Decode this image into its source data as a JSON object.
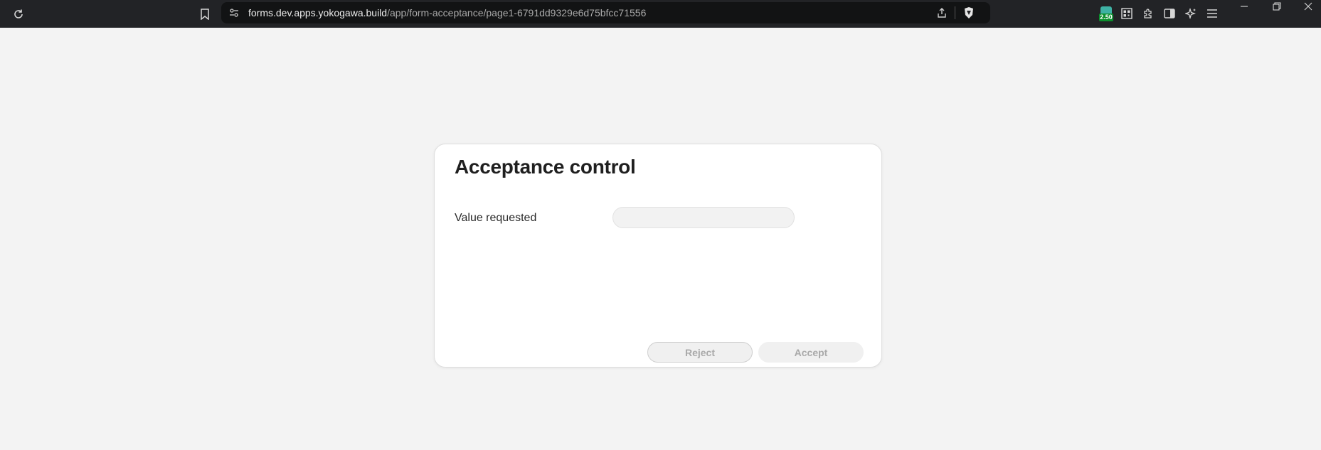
{
  "browser": {
    "url_host": "forms.dev.apps.yokogawa.build",
    "url_path": "/app/form-acceptance/page1-6791dd9329e6d75bfcc71556",
    "extension_badge": "2.50",
    "icons": [
      "reload-icon",
      "bookmark-icon",
      "site-info-icon",
      "share-icon",
      "brave-shield-icon",
      "qr-code-icon",
      "extensions-icon",
      "sidebar-icon",
      "leo-ai-icon",
      "menu-icon",
      "minimize-icon",
      "restore-icon",
      "close-icon"
    ]
  },
  "form": {
    "title": "Acceptance control",
    "field_label": "Value requested",
    "field_value": "",
    "reject_label": "Reject",
    "accept_label": "Accept"
  },
  "colors": {
    "chrome_bg": "#222326",
    "page_bg": "#f3f3f3",
    "card_bg": "#ffffff",
    "disabled_text": "#a9a9a9"
  }
}
